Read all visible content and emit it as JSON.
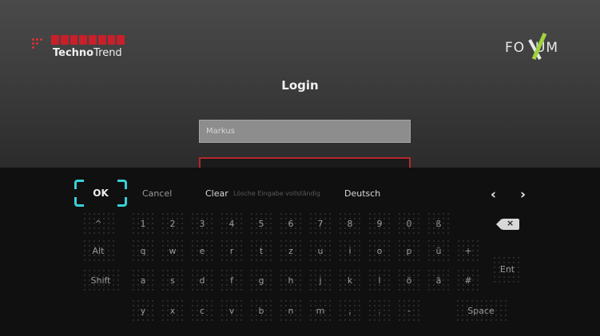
{
  "brand": {
    "name_bold": "Techno",
    "name_light": "Trend",
    "partner": "FO  UM"
  },
  "login": {
    "title": "Login",
    "username_value": "Markus",
    "password_value": ""
  },
  "keyboard": {
    "ok_label": "OK",
    "cancel_label": "Cancel",
    "clear_label": "Clear",
    "hint_text": "Lösche Eingabe vollständig",
    "language_label": "Deutsch",
    "row1": [
      "1",
      "2",
      "3",
      "4",
      "5",
      "6",
      "7",
      "8",
      "9",
      "0",
      "ß"
    ],
    "row2": [
      "q",
      "w",
      "e",
      "r",
      "t",
      "z",
      "u",
      "i",
      "o",
      "p",
      "ü",
      "+"
    ],
    "row3": [
      "a",
      "s",
      "d",
      "f",
      "g",
      "h",
      "j",
      "k",
      "l",
      "ö",
      "ä",
      "#"
    ],
    "row4": [
      "y",
      "x",
      "c",
      "v",
      "b",
      "n",
      "m",
      ",",
      ".",
      "-"
    ],
    "caret_label": "^",
    "alt_label": "Alt",
    "shift_label": "Shift",
    "enter_label": "Ent",
    "space_label": "Space",
    "arrow_left": "‹",
    "arrow_right": "›",
    "backspace_glyph": "×"
  },
  "colors": {
    "accent_focus": "#39d0d8",
    "field_error": "#b5282e",
    "brand_red": "#c8202a",
    "fox_green": "#9fd23c"
  }
}
